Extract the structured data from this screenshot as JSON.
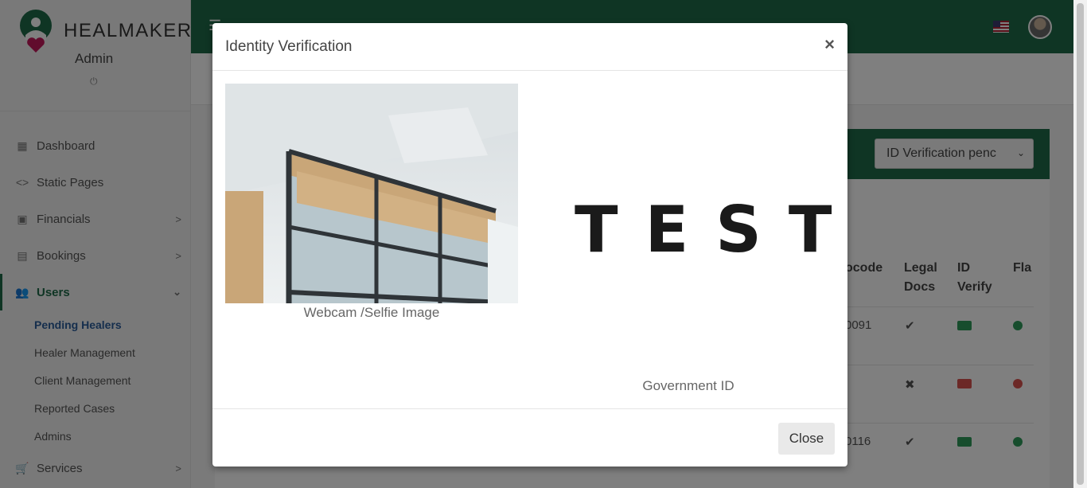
{
  "sidebar": {
    "brand": "HEALMAKER",
    "role": "Admin",
    "power_icon": "power-icon",
    "items": [
      {
        "label": "Dashboard",
        "icon": "dashboard-icon"
      },
      {
        "label": "Static Pages",
        "icon": "code-icon"
      },
      {
        "label": "Financials",
        "icon": "money-icon"
      },
      {
        "label": "Bookings",
        "icon": "calendar-icon"
      },
      {
        "label": "Users",
        "icon": "users-icon"
      },
      {
        "label": "Services",
        "icon": "cart-icon"
      }
    ],
    "users_sub": [
      "Pending Healers",
      "Healer Management",
      "Client Management",
      "Reported Cases",
      "Admins"
    ]
  },
  "header": {
    "flag_icon": "us-flag-icon",
    "menu_icon": "hamburger-icon"
  },
  "card": {
    "filter_value": "ID Verification penc",
    "headers": {
      "code": "ocode",
      "legal": "Legal Docs",
      "id_verify": "ID Verify",
      "flag": "Fla"
    },
    "rows": [
      {
        "code": "0091",
        "legal_icon": "check-icon",
        "id_status": "verified"
      },
      {
        "code": "",
        "legal_icon": "x-icon",
        "id_status": "rejected"
      },
      {
        "code": "0116",
        "legal_icon": "check-icon",
        "id_status": "verified"
      }
    ]
  },
  "modal": {
    "title": "Identity Verification",
    "close_symbol": "×",
    "selfie_caption": "Webcam /Selfie Image",
    "govid_text": "TEST",
    "govid_caption": "Government ID",
    "close_button": "Close"
  },
  "colors": {
    "brand_green": "#1f6b49",
    "active_link": "#2b5c9a"
  }
}
